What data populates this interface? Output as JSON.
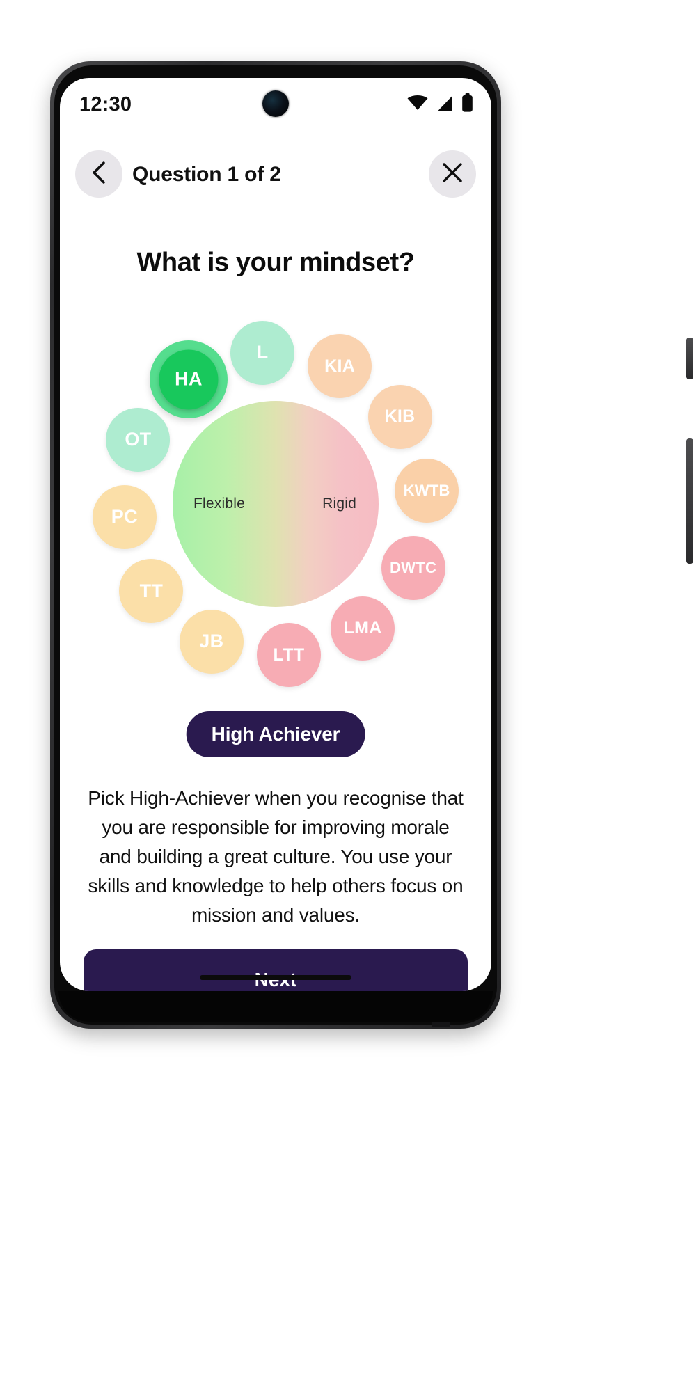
{
  "statusbar": {
    "time": "12:30",
    "icons": [
      "wifi-icon",
      "cellular-signal-icon",
      "battery-icon"
    ]
  },
  "header": {
    "back_icon": "chevron-left-icon",
    "close_icon": "close-x-icon",
    "title": "Question 1 of 2"
  },
  "question": {
    "title": "What is your mindset?"
  },
  "wheel": {
    "center": {
      "left_label": "Flexible",
      "right_label": "Rigid",
      "gradient_from": "#a7f0a8",
      "gradient_to": "#f6bcc3"
    },
    "bubbles": [
      {
        "id": "HA",
        "label": "HA",
        "color": "#18c85c",
        "ring": "#55dd8e",
        "selected": true,
        "size": 112,
        "angle": -125
      },
      {
        "id": "L",
        "label": "L",
        "color": "#aeecd0",
        "selected": false,
        "size": 92,
        "angle": -95
      },
      {
        "id": "KIA",
        "label": "KIA",
        "color": "#fad3b0",
        "selected": false,
        "size": 92,
        "angle": -65
      },
      {
        "id": "KIB",
        "label": "KIB",
        "color": "#fad3b0",
        "selected": false,
        "size": 92,
        "angle": -35
      },
      {
        "id": "KWTB",
        "label": "KWTB",
        "color": "#fad0a8",
        "selected": false,
        "size": 92,
        "angle": -5
      },
      {
        "id": "DWTC",
        "label": "DWTC",
        "color": "#f7acb4",
        "selected": false,
        "size": 92,
        "angle": 25
      },
      {
        "id": "LMA",
        "label": "LMA",
        "color": "#f7acb4",
        "selected": false,
        "size": 92,
        "angle": 55
      },
      {
        "id": "LTT",
        "label": "LTT",
        "color": "#f7acb4",
        "selected": false,
        "size": 92,
        "angle": 85
      },
      {
        "id": "JB",
        "label": "JB",
        "color": "#fbdfa8",
        "selected": false,
        "size": 92,
        "angle": 115
      },
      {
        "id": "TT",
        "label": "TT",
        "color": "#fbdfa8",
        "selected": false,
        "size": 92,
        "angle": 145
      },
      {
        "id": "PC",
        "label": "PC",
        "color": "#fbdfa8",
        "selected": false,
        "size": 92,
        "angle": 175
      },
      {
        "id": "OT",
        "label": "OT",
        "color": "#aeecd0",
        "selected": false,
        "size": 92,
        "angle": -155
      }
    ]
  },
  "selection": {
    "pill_label": "High Achiever",
    "pill_color": "#2a1a4f",
    "description": "Pick High-Achiever when you recognise that you are responsible for improving morale and building a great culture. You use your skills and knowledge to help others focus on mission and values."
  },
  "footer": {
    "next_label": "Next",
    "next_color": "#2a1a4f"
  }
}
